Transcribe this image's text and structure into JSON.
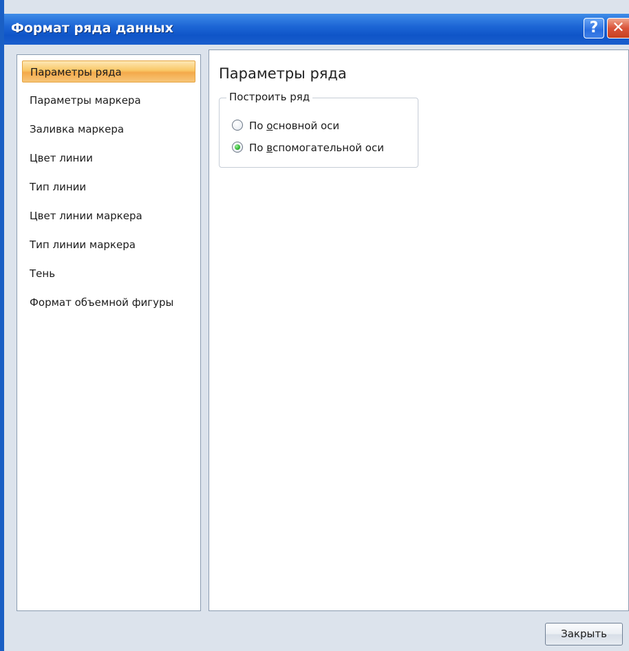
{
  "window": {
    "title": "Формат ряда данных",
    "help_label": "?",
    "close_label": "✕"
  },
  "nav": {
    "selected_index": 0,
    "items": [
      {
        "label": "Параметры ряда"
      },
      {
        "label": "Параметры маркера"
      },
      {
        "label": "Заливка маркера"
      },
      {
        "label": "Цвет линии"
      },
      {
        "label": "Тип линии"
      },
      {
        "label": "Цвет линии маркера"
      },
      {
        "label": "Тип линии маркера"
      },
      {
        "label": "Тень"
      },
      {
        "label": "Формат объемной фигуры"
      }
    ]
  },
  "content": {
    "section_title": "Параметры ряда",
    "plot_series_group": {
      "legend": "Построить ряд",
      "options": [
        {
          "prefix": "По ",
          "accel": "о",
          "rest": "сновной оси",
          "checked": false
        },
        {
          "prefix": "По ",
          "accel": "в",
          "rest": "спомогательной оси",
          "checked": true
        }
      ]
    }
  },
  "footer": {
    "close_button_label": "Закрыть"
  },
  "colors": {
    "titlebar": "#1d66d6",
    "selected_item": "#f9c766",
    "dialog_bg": "#dce3ec"
  }
}
